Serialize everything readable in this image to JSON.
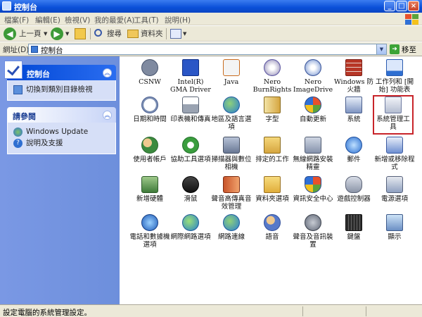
{
  "window": {
    "title": "控制台"
  },
  "menu": [
    "檔案(F)",
    "編輯(E)",
    "檢視(V)",
    "我的最愛(A)",
    "工具(T)",
    "說明(H)"
  ],
  "toolbar": {
    "back": "上一頁",
    "search": "搜尋",
    "folders": "資料夾"
  },
  "address": {
    "label": "網址(D)",
    "value": "控制台",
    "go": "移至"
  },
  "left": {
    "panel1": {
      "title": "控制台",
      "items": [
        "切換到類別目錄檢視"
      ]
    },
    "panel2": {
      "title": "請參閱",
      "items": [
        "Windows Update",
        "說明及支援"
      ]
    }
  },
  "items": [
    {
      "label": "CSNW",
      "icon": "csnw-icon"
    },
    {
      "label": "Intel(R) GMA Driver",
      "icon": "intel-gma-driver-icon"
    },
    {
      "label": "Java",
      "icon": "java-icon"
    },
    {
      "label": "Nero BurnRights",
      "icon": "nero-burnrights-icon"
    },
    {
      "label": "Nero ImageDrive",
      "icon": "nero-imagedrive-icon"
    },
    {
      "label": "Windows 防火牆",
      "icon": "firewall-icon"
    },
    {
      "label": "工作列和 [開始] 功能表",
      "icon": "taskbar-start-menu-icon"
    },
    {
      "label": "日期和時間",
      "icon": "date-time-icon"
    },
    {
      "label": "印表機和傳真",
      "icon": "printers-fax-icon"
    },
    {
      "label": "地區及語言選項",
      "icon": "regional-language-icon"
    },
    {
      "label": "字型",
      "icon": "fonts-icon"
    },
    {
      "label": "自動更新",
      "icon": "automatic-updates-icon"
    },
    {
      "label": "系統",
      "icon": "system-icon"
    },
    {
      "label": "系統管理工具",
      "icon": "administrative-tools-icon"
    },
    {
      "label": "使用者帳戶",
      "icon": "user-accounts-icon"
    },
    {
      "label": "協助工具選項",
      "icon": "accessibility-icon"
    },
    {
      "label": "掃描器與數位相機",
      "icon": "scanners-cameras-icon"
    },
    {
      "label": "排定的工作",
      "icon": "scheduled-tasks-icon"
    },
    {
      "label": "無線網路安裝精靈",
      "icon": "wireless-network-setup-icon"
    },
    {
      "label": "郵件",
      "icon": "mail-icon"
    },
    {
      "label": "新增或移除程式",
      "icon": "add-remove-programs-icon"
    },
    {
      "label": "新增硬體",
      "icon": "add-hardware-icon"
    },
    {
      "label": "滑鼠",
      "icon": "mouse-icon"
    },
    {
      "label": "聲音高傳真音效管理",
      "icon": "audio-manager-icon"
    },
    {
      "label": "資料夾選項",
      "icon": "folder-options-icon"
    },
    {
      "label": "資訊安全中心",
      "icon": "security-center-icon"
    },
    {
      "label": "遊戲控制器",
      "icon": "game-controllers-icon"
    },
    {
      "label": "電源選項",
      "icon": "power-options-icon"
    },
    {
      "label": "電話和數據機選項",
      "icon": "phone-modem-icon"
    },
    {
      "label": "網際網路選項",
      "icon": "internet-options-icon"
    },
    {
      "label": "網路連線",
      "icon": "network-connections-icon"
    },
    {
      "label": "語音",
      "icon": "speech-icon"
    },
    {
      "label": "聲音及音訊裝置",
      "icon": "sounds-audio-icon"
    },
    {
      "label": "鍵盤",
      "icon": "keyboard-icon"
    },
    {
      "label": "顯示",
      "icon": "display-icon"
    }
  ],
  "selected_item": "系統管理工具",
  "status": {
    "text": "設定電腦的系統管理設定。"
  }
}
